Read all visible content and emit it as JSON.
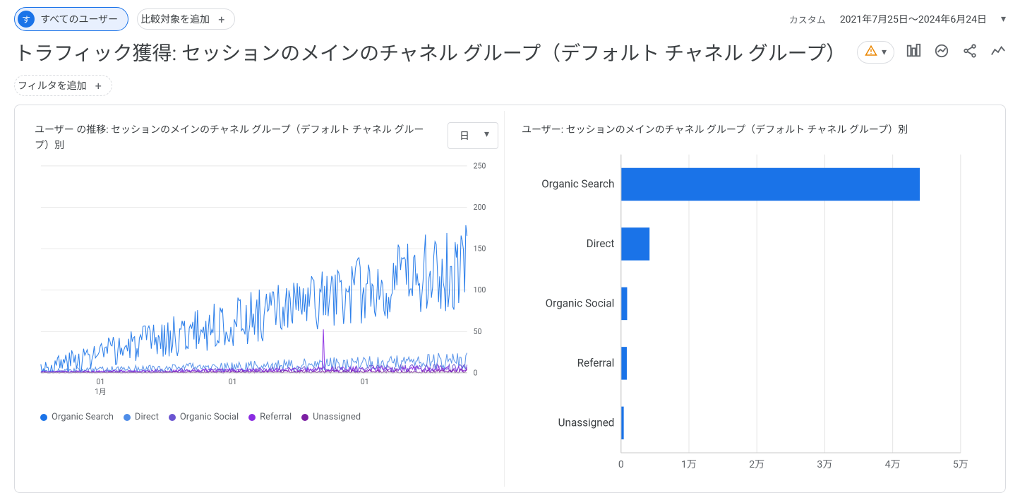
{
  "topbar": {
    "segment_label": "すべてのユーザー",
    "segment_avatar": "す",
    "add_compare_label": "比較対象を追加",
    "date_label": "カスタム",
    "date_range": "2021年7月25日～2024年6月24日"
  },
  "header": {
    "title": "トラフィック獲得: セッションのメインのチャネル グループ（デフォルト チャネル グループ）",
    "add_filter_label": "フィルタを追加"
  },
  "colors": {
    "Organic Search": "#1a73e8",
    "Direct": "#4f8de8",
    "Organic Social": "#6a54d1",
    "Referral": "#8a2be2",
    "Unassigned": "#7b1fa2"
  },
  "chart_data": [
    {
      "type": "line",
      "title": "ユーザー の推移: セッションのメインのチャネル グループ（デフォルト チャネル グループ）別",
      "granularity_label": "日",
      "xlabel": "",
      "ylabel": "",
      "ylim": [
        0,
        250
      ],
      "yticks": [
        0,
        50,
        100,
        150,
        200,
        250
      ],
      "xticks": [
        "01",
        "01",
        "01"
      ],
      "xlabel_extra": "1月",
      "legend": [
        "Organic Search",
        "Direct",
        "Organic Social",
        "Referral",
        "Unassigned"
      ],
      "series": [
        {
          "name": "Organic Search",
          "trend_start": 5,
          "trend_end": 130,
          "noise": 40,
          "spike_max": 185
        },
        {
          "name": "Direct",
          "trend_start": 2,
          "trend_end": 15,
          "noise": 8,
          "spike_max": 25
        },
        {
          "name": "Organic Social",
          "trend_start": 1,
          "trend_end": 6,
          "noise": 4,
          "spike_max": 12
        },
        {
          "name": "Referral",
          "trend_start": 1,
          "trend_end": 5,
          "noise": 3,
          "spike_max": 60
        },
        {
          "name": "Unassigned",
          "trend_start": 0,
          "trend_end": 2,
          "noise": 2,
          "spike_max": 5
        }
      ],
      "n_points": 360
    },
    {
      "type": "bar",
      "title": "ユーザー: セッションのメインのチャネル グループ（デフォルト チャネル グループ）別",
      "xlabel": "",
      "ylabel": "",
      "xlim": [
        0,
        50000
      ],
      "xticks": [
        0,
        10000,
        20000,
        30000,
        40000,
        50000
      ],
      "xtick_labels": [
        "0",
        "1万",
        "2万",
        "3万",
        "4万",
        "5万"
      ],
      "categories": [
        "Organic Search",
        "Direct",
        "Organic Social",
        "Referral",
        "Unassigned"
      ],
      "values": [
        44000,
        4200,
        900,
        850,
        400
      ]
    }
  ]
}
